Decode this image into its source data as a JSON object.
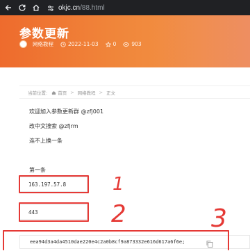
{
  "browser": {
    "url_domain": "okjc.cn",
    "url_path": "/88.html"
  },
  "hero": {
    "title": "参数更新",
    "author": "网络教程",
    "date": "2022-11-03",
    "stars": "0",
    "views": "903"
  },
  "breadcrumb": {
    "current_label": "当前位置:",
    "home": "首页",
    "category": "网络教程",
    "page": "正文"
  },
  "content": {
    "line1": "欢迎加入参数更新群 @zfj001",
    "line2": "改中文搜索 @zfjrm",
    "line3": "连不上换一条",
    "section_label": "第一条",
    "field1_value": "163.197.57.8",
    "field2_value": "443",
    "field3_value": "eea94d3a4da4510dae220e4c2a0b8cf9a873332e616d617a6f6e;"
  },
  "annotations": {
    "num1": "1",
    "num2": "2",
    "num3": "3",
    "color": "#e53935"
  },
  "colors": {
    "hero_start": "#ee6b2d",
    "hero_end": "#f49a4a",
    "browser_bg": "#202124"
  }
}
